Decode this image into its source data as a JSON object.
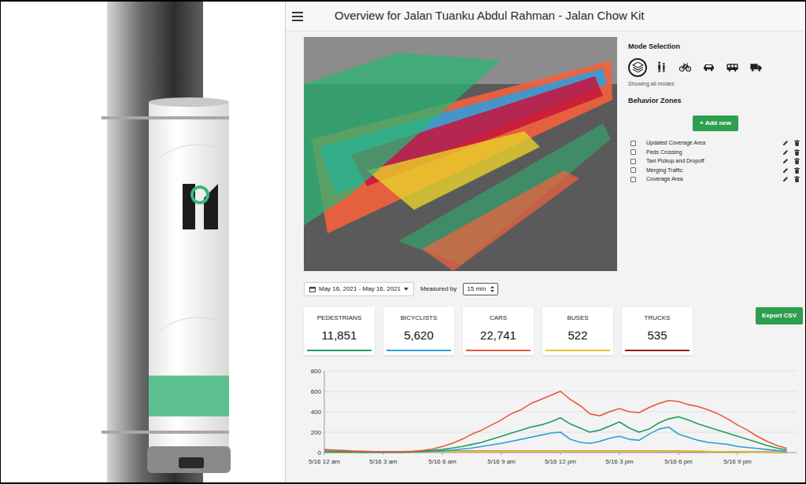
{
  "header": {
    "title": "Overview for Jalan Tuanku Abdul Rahman - Jalan Chow Kit"
  },
  "mode_selection": {
    "title": "Mode Selection",
    "modes": [
      {
        "kind": "all",
        "selected": true
      },
      {
        "kind": "pedestrian",
        "selected": false
      },
      {
        "kind": "bicycle",
        "selected": false
      },
      {
        "kind": "car",
        "selected": false
      },
      {
        "kind": "bus",
        "selected": false
      },
      {
        "kind": "truck",
        "selected": false
      }
    ],
    "caption": "Showing all modes"
  },
  "behavior_zones": {
    "title": "Behavior Zones",
    "add_button": "+ Add new",
    "zones": [
      {
        "label": "Updated Coverage Area",
        "checked": false
      },
      {
        "label": "Peds Crossing",
        "checked": false
      },
      {
        "label": "Taxi Pickup and Dropoff",
        "checked": false
      },
      {
        "label": "Merging Traffic",
        "checked": false
      },
      {
        "label": "Coverage Area",
        "checked": false
      }
    ]
  },
  "filters": {
    "date_range": "May 16, 2021 - May 16, 2021",
    "measured_by_label": "Measured by",
    "interval": "15 min"
  },
  "export_button": "Export CSV",
  "stats": [
    {
      "label": "PEDESTRIANS",
      "value": "11,851",
      "color": "#1e9e5e"
    },
    {
      "label": "BICYCLISTS",
      "value": "5,620",
      "color": "#2a9fd8"
    },
    {
      "label": "CARS",
      "value": "22,741",
      "color": "#e9573a"
    },
    {
      "label": "BUSES",
      "value": "522",
      "color": "#e6c229"
    },
    {
      "label": "TRUCKS",
      "value": "535",
      "color": "#8b1c1c"
    }
  ],
  "chart": {
    "y_ticks": [
      "800",
      "600",
      "400",
      "200",
      "0"
    ],
    "x_ticks": [
      "5/16 12 am",
      "5/16 3 am",
      "5/16 6 am",
      "5/16 9 am",
      "5/16 12 pm",
      "5/16 3 pm",
      "5/16 6 pm",
      "5/16 9 pm"
    ],
    "series": [
      {
        "color": "#e9573a",
        "values": [
          30,
          25,
          20,
          15,
          12,
          10,
          10,
          8,
          10,
          12,
          20,
          35,
          60,
          90,
          130,
          180,
          220,
          270,
          320,
          380,
          420,
          480,
          520,
          560,
          600,
          520,
          460,
          380,
          360,
          400,
          430,
          400,
          390,
          440,
          480,
          510,
          500,
          470,
          450,
          420,
          380,
          330,
          270,
          220,
          160,
          110,
          70,
          40
        ]
      },
      {
        "color": "#1e9e5e",
        "values": [
          15,
          12,
          10,
          8,
          6,
          5,
          5,
          5,
          6,
          8,
          12,
          20,
          30,
          45,
          60,
          80,
          100,
          130,
          160,
          190,
          220,
          250,
          270,
          300,
          340,
          280,
          240,
          200,
          220,
          260,
          300,
          240,
          200,
          230,
          290,
          330,
          350,
          320,
          280,
          250,
          220,
          190,
          160,
          130,
          100,
          70,
          45,
          25
        ]
      },
      {
        "color": "#2a9fd8",
        "values": [
          8,
          6,
          5,
          4,
          3,
          3,
          3,
          3,
          4,
          5,
          8,
          12,
          18,
          25,
          35,
          45,
          60,
          75,
          90,
          110,
          130,
          150,
          170,
          190,
          200,
          130,
          100,
          90,
          110,
          140,
          160,
          130,
          120,
          180,
          230,
          250,
          180,
          150,
          120,
          100,
          90,
          80,
          60,
          50,
          40,
          30,
          20,
          12
        ]
      },
      {
        "color": "#e6c229",
        "values": [
          2,
          1,
          1,
          1,
          1,
          1,
          1,
          1,
          2,
          3,
          5,
          7,
          8,
          9,
          10,
          10,
          10,
          11,
          11,
          12,
          12,
          12,
          12,
          12,
          12,
          12,
          12,
          12,
          12,
          12,
          12,
          12,
          12,
          12,
          13,
          13,
          13,
          12,
          12,
          11,
          10,
          9,
          8,
          7,
          6,
          4,
          3,
          2
        ]
      },
      {
        "color": "#8b1c1c",
        "values": [
          3,
          2,
          2,
          2,
          2,
          2,
          2,
          3,
          4,
          6,
          8,
          10,
          12,
          12,
          12,
          12,
          12,
          12,
          12,
          12,
          12,
          12,
          12,
          12,
          12,
          12,
          12,
          12,
          12,
          12,
          12,
          12,
          12,
          12,
          12,
          12,
          12,
          11,
          11,
          10,
          10,
          9,
          8,
          7,
          6,
          5,
          4,
          3
        ]
      }
    ]
  }
}
